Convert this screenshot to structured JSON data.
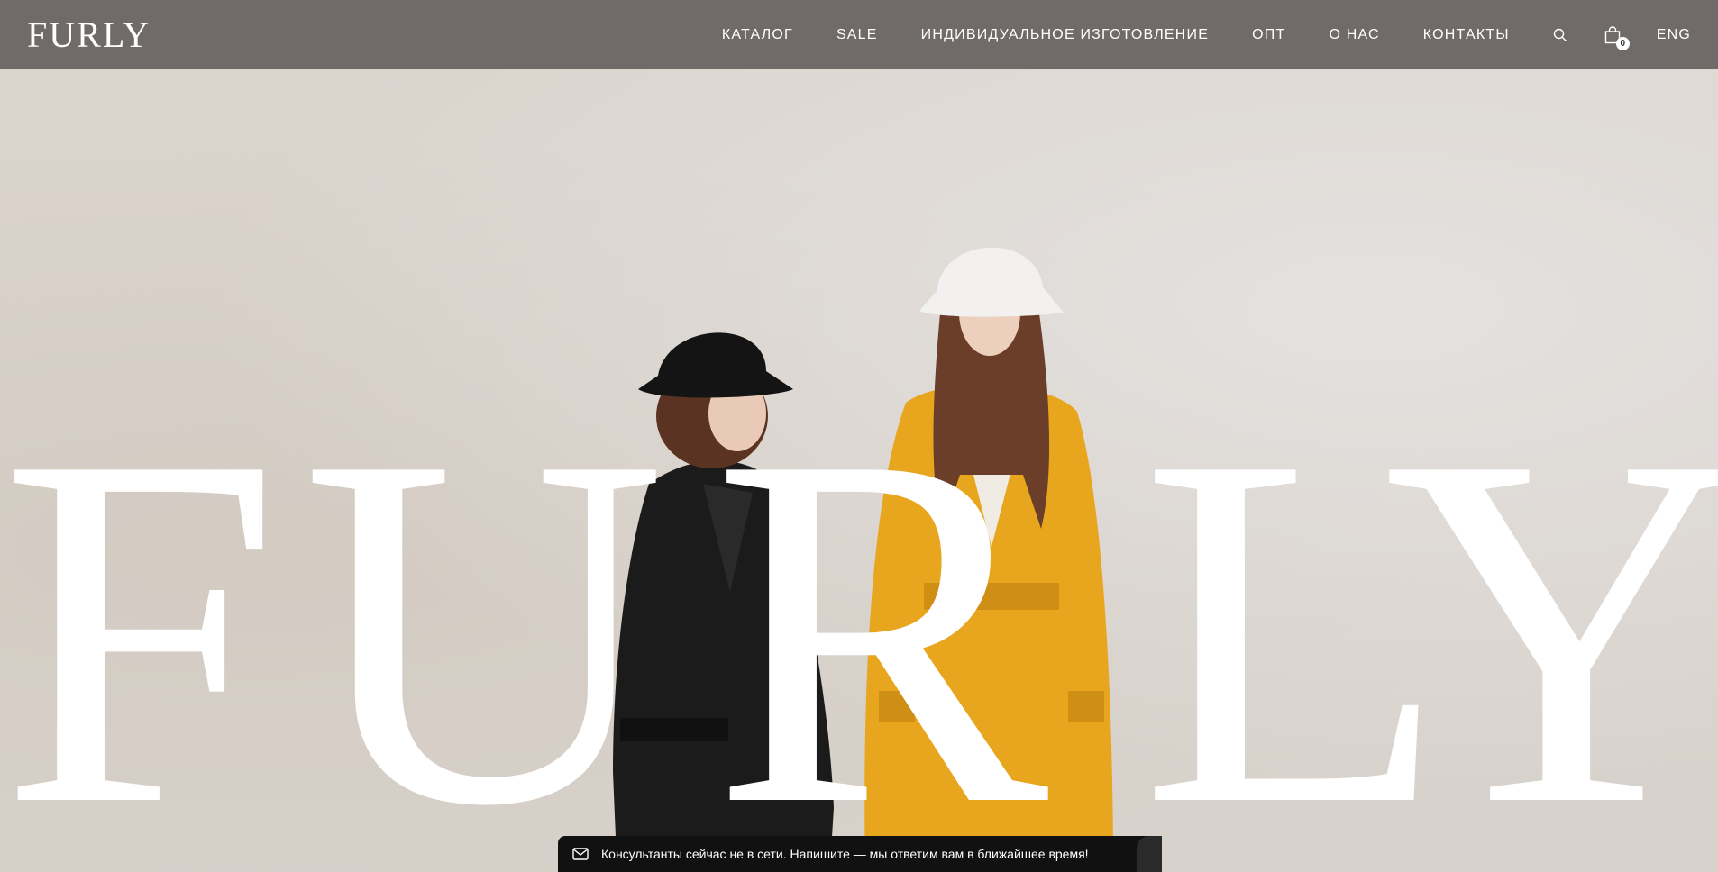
{
  "header": {
    "logo": "FURLY",
    "nav": [
      {
        "label": "КАТАЛОГ"
      },
      {
        "label": "SALE"
      },
      {
        "label": "ИНДИВИДУАЛЬНОЕ ИЗГОТОВЛЕНИЕ"
      },
      {
        "label": "ОПТ"
      },
      {
        "label": "О НАС"
      },
      {
        "label": "КОНТАКТЫ"
      }
    ],
    "search_icon": "search-icon",
    "cart_icon": "shopping-bag-icon",
    "cart_count": "0",
    "language": "ENG",
    "background_color": "#706b68"
  },
  "hero": {
    "letters": [
      "F",
      "U",
      "R",
      "L",
      "Y"
    ],
    "letter_color": "#ffffff",
    "background_color": "#d9d3cc"
  },
  "chat": {
    "icon": "envelope-icon",
    "text": "Консультанты сейчас не в сети. Напишите — мы ответим вам в ближайшее время!"
  }
}
